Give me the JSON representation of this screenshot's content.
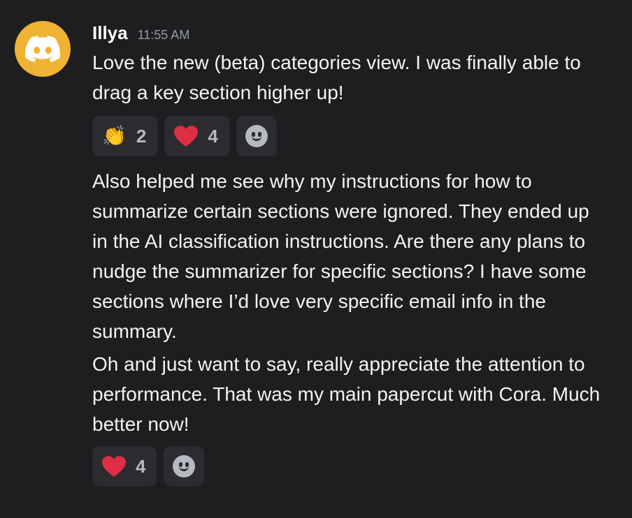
{
  "message": {
    "username": "Illya",
    "timestamp": "11:55 AM",
    "avatar_icon": "discord-icon",
    "avatar_color": "#f0b232",
    "paragraphs": [
      "Love the new (beta) categories view. I was finally able to drag a key section higher up!",
      "Also helped me see why my instructions for how to summarize certain sections were ignored. They ended up in the AI classification instructions. Are there any plans to nudge the summarizer for specific sections? I have some sections where I’d love very specific email info in the summary.",
      "Oh and just want to say, really appreciate the attention to performance. That was my main papercut with Cora. Much better now!"
    ],
    "reactions_first": [
      {
        "emoji": "clapping-hands-icon",
        "count": "2"
      },
      {
        "emoji": "red-heart-icon",
        "count": "4"
      }
    ],
    "reactions_second": [
      {
        "emoji": "red-heart-icon",
        "count": "4"
      }
    ]
  }
}
